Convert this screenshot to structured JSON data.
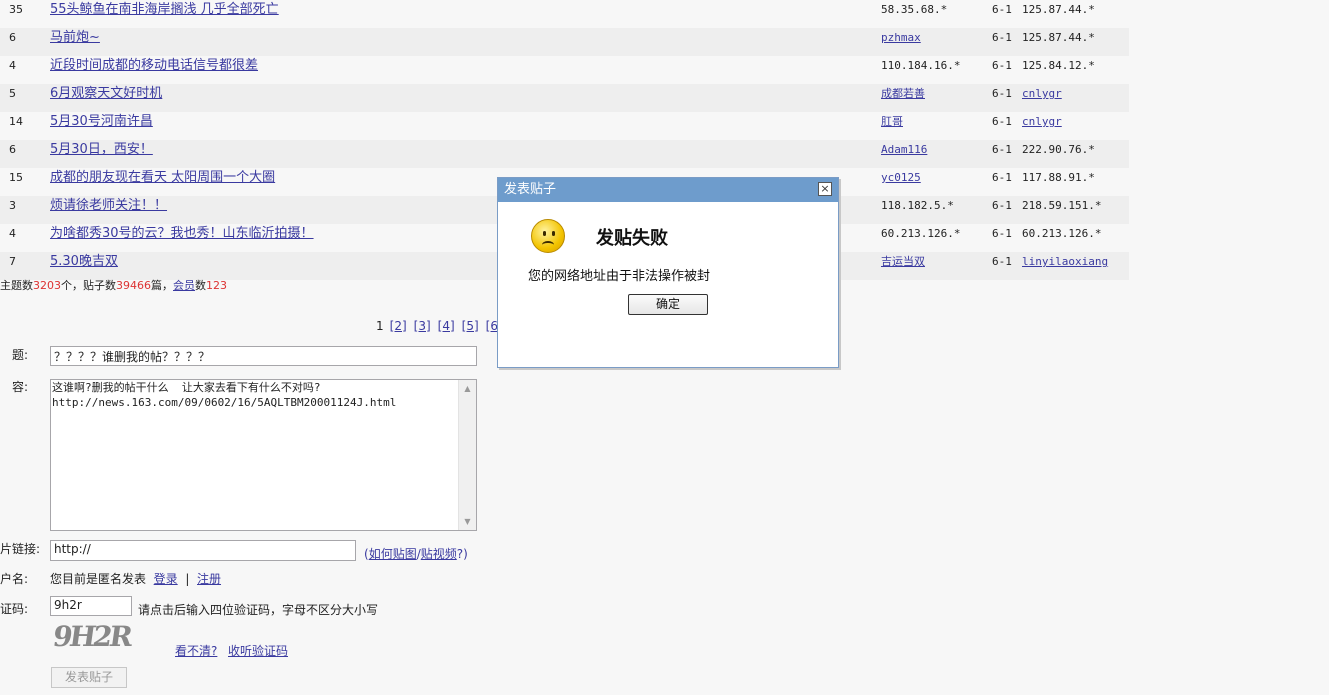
{
  "topics": [
    {
      "replies": "35",
      "title": "55头鲸鱼在南非海岸搁浅 几乎全部死亡",
      "author": "58.35.68.*",
      "author_link": false,
      "date": "6-1",
      "last_reply": "125.87.44.*",
      "last_link": false
    },
    {
      "replies": "6",
      "title": "马前炮~",
      "author": "pzhmax",
      "author_link": true,
      "date": "6-1",
      "last_reply": "125.87.44.*",
      "last_link": false
    },
    {
      "replies": "4",
      "title": "近段时间成都的移动电话信号都很差",
      "author": "110.184.16.*",
      "author_link": false,
      "date": "6-1",
      "last_reply": "125.84.12.*",
      "last_link": false
    },
    {
      "replies": "5",
      "title": "6月观察天文好时机",
      "author": "成都若善",
      "author_link": true,
      "date": "6-1",
      "last_reply": "cnlygr",
      "last_link": true
    },
    {
      "replies": "14",
      "title": "5月30号河南许昌",
      "author": "肛哥",
      "author_link": true,
      "date": "6-1",
      "last_reply": "cnlygr",
      "last_link": true
    },
    {
      "replies": "6",
      "title": "5月30日，西安！",
      "author": "Adam116",
      "author_link": true,
      "date": "6-1",
      "last_reply": "222.90.76.*",
      "last_link": false
    },
    {
      "replies": "15",
      "title": "成都的朋友现在看天  太阳周围一个大圈",
      "author": "yc0125",
      "author_link": true,
      "date": "6-1",
      "last_reply": "117.88.91.*",
      "last_link": false
    },
    {
      "replies": "3",
      "title": "烦请徐老师关注！！",
      "author": "118.182.5.*",
      "author_link": false,
      "date": "6-1",
      "last_reply": "218.59.151.*",
      "last_link": false
    },
    {
      "replies": "4",
      "title": "为啥都秀30号的云？我也秀！山东临沂拍摄！",
      "author": "60.213.126.*",
      "author_link": false,
      "date": "6-1",
      "last_reply": "60.213.126.*",
      "last_link": false
    },
    {
      "replies": "7",
      "title": "5.30晚吉双",
      "author": "吉运当双",
      "author_link": true,
      "date": "6-1",
      "last_reply": "linyilaoxiang",
      "last_link": true
    }
  ],
  "stats": {
    "p1": "主题数",
    "topics": "3203",
    "p2": "个，贴子数",
    "posts": "39466",
    "p3": "篇，",
    "members_link": "会员",
    "p4": "数",
    "members": "123"
  },
  "pager": {
    "current": "1",
    "pages": [
      "[2]",
      "[3]",
      "[4]",
      "[5]",
      "[6"
    ]
  },
  "form": {
    "subject_label": "题:",
    "subject_value": "？？？？谁删我的帖？？？？",
    "content_label": "容:",
    "content_value": "这谁啊?删我的帖干什么  让大家去看下有什么不对吗?\nhttp://news.163.com/09/0602/16/5AQLTBM20001124J.html",
    "image_label": "片链接:",
    "image_value": "http://",
    "help_open": "(",
    "help_image": "如何贴图",
    "help_sep": "/",
    "help_video": "贴视频",
    "help_close": "?)",
    "user_label": "户名:",
    "anon_text": "您目前是匿名发表",
    "login": "登录",
    "bar": "|",
    "register": "注册",
    "captcha_label": "证码:",
    "captcha_value": "9h2r",
    "captcha_hint": "请点击后输入四位验证码，字母不区分大小写",
    "captcha_image_text": "9H2R",
    "cant_see": "看不清?",
    "listen": "收听验证码",
    "submit": "发表贴子"
  },
  "dialog": {
    "title": "发表贴子",
    "close": "×",
    "heading": "发贴失败",
    "message": "您的网络地址由于非法操作被封",
    "ok": "确定",
    "icon": "sad-face-icon"
  }
}
